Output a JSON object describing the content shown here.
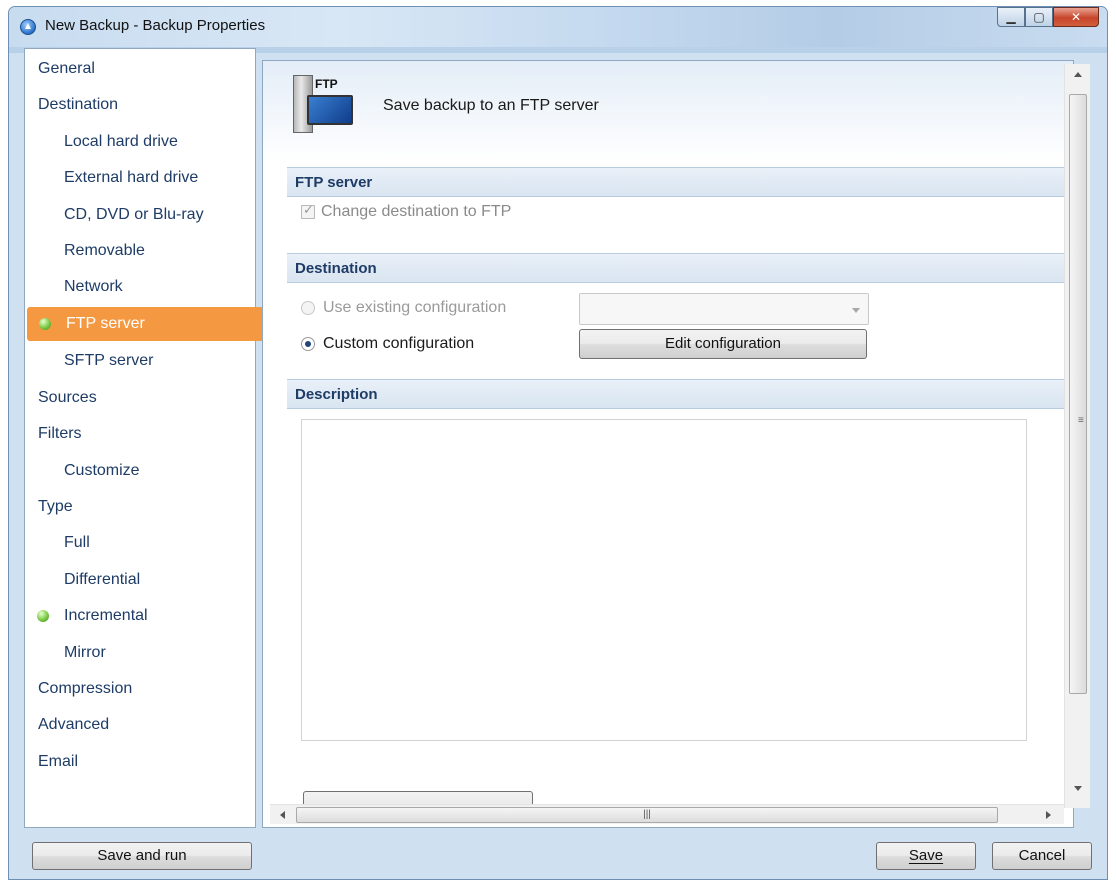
{
  "window": {
    "title": "New Backup - Backup Properties"
  },
  "nav": {
    "items": [
      {
        "label": "General",
        "level": "top"
      },
      {
        "label": "Destination",
        "level": "top"
      },
      {
        "label": "Local hard drive",
        "level": "sub"
      },
      {
        "label": "External hard drive",
        "level": "sub"
      },
      {
        "label": "CD, DVD or Blu-ray",
        "level": "sub"
      },
      {
        "label": "Removable",
        "level": "sub"
      },
      {
        "label": "Network",
        "level": "sub"
      },
      {
        "label": "FTP server",
        "level": "sub",
        "selected": true,
        "indicator": "green-dot"
      },
      {
        "label": "SFTP server",
        "level": "sub"
      },
      {
        "label": "Sources",
        "level": "top"
      },
      {
        "label": "Filters",
        "level": "top"
      },
      {
        "label": "Customize",
        "level": "sub"
      },
      {
        "label": "Type",
        "level": "top"
      },
      {
        "label": "Full",
        "level": "sub"
      },
      {
        "label": "Differential",
        "level": "sub"
      },
      {
        "label": "Incremental",
        "level": "sub",
        "indicator": "green-dot"
      },
      {
        "label": "Mirror",
        "level": "sub"
      },
      {
        "label": "Compression",
        "level": "top"
      },
      {
        "label": "Advanced",
        "level": "top"
      },
      {
        "label": "Email",
        "level": "top"
      }
    ],
    "selected_color": "#f59842"
  },
  "content": {
    "header_icon_label": "FTP",
    "header_title": "Save backup to an FTP server",
    "sections": {
      "ftp_server": "FTP server",
      "destination": "Destination",
      "description": "Description"
    },
    "change_destination_label": "Change destination to FTP",
    "use_existing_label": "Use existing configuration",
    "custom_config_label": "Custom configuration",
    "edit_config_button": "Edit configuration",
    "description_text": ""
  },
  "footer": {
    "save_and_run": "Save and run",
    "save": "Save",
    "cancel": "Cancel"
  }
}
